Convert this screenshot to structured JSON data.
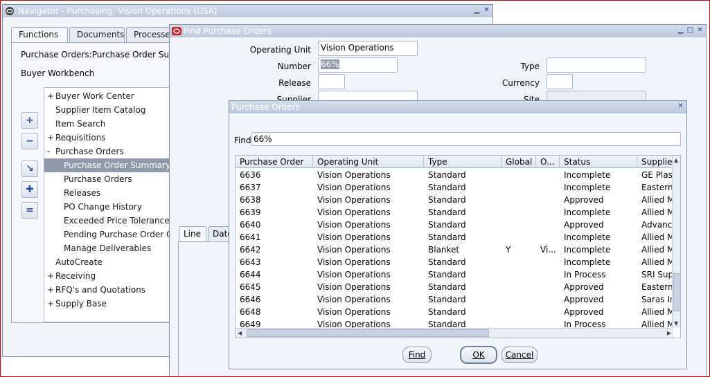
{
  "navigator": {
    "title": "Navigator - Purchasing, Vision Operations (USA)",
    "tabs": [
      "Functions",
      "Documents",
      "Processes"
    ],
    "breadcrumb": "Purchase Orders:Purchase Order Summary",
    "top_item": "Buyer Workbench",
    "tree": [
      {
        "prefix": "+",
        "label": "Buyer Work Center",
        "level": 0,
        "selected": false
      },
      {
        "prefix": "",
        "label": "Supplier Item Catalog",
        "level": 0,
        "selected": false
      },
      {
        "prefix": "",
        "label": "Item Search",
        "level": 0,
        "selected": false
      },
      {
        "prefix": "+",
        "label": "Requisitions",
        "level": 0,
        "selected": false
      },
      {
        "prefix": "-",
        "label": "Purchase Orders",
        "level": 0,
        "selected": false
      },
      {
        "prefix": "",
        "label": "Purchase Order Summary",
        "level": 1,
        "selected": true
      },
      {
        "prefix": "",
        "label": "Purchase Orders",
        "level": 1,
        "selected": false
      },
      {
        "prefix": "",
        "label": "Releases",
        "level": 1,
        "selected": false
      },
      {
        "prefix": "",
        "label": "PO Change History",
        "level": 1,
        "selected": false
      },
      {
        "prefix": "",
        "label": "Exceeded Price Tolerances",
        "level": 1,
        "selected": false
      },
      {
        "prefix": "",
        "label": "Pending Purchase Order Changes",
        "level": 1,
        "selected": false
      },
      {
        "prefix": "",
        "label": "Manage Deliverables",
        "level": 1,
        "selected": false
      },
      {
        "prefix": "",
        "label": "AutoCreate",
        "level": 0,
        "selected": false
      },
      {
        "prefix": "+",
        "label": "Receiving",
        "level": 0,
        "selected": false
      },
      {
        "prefix": "+",
        "label": "RFQ's and Quotations",
        "level": 0,
        "selected": false
      },
      {
        "prefix": "+",
        "label": "Supply Base",
        "level": 0,
        "selected": false
      }
    ]
  },
  "find_window": {
    "title": "Find Purchase Orders",
    "operating_unit_label": "Operating Unit",
    "operating_unit_value": "Vision Operations",
    "number_label": "Number",
    "number_value": "66%",
    "release_label": "Release",
    "supplier_label": "Supplier",
    "type_label": "Type",
    "currency_label": "Currency",
    "site_label": "Site",
    "tabs": [
      "Line",
      "Date"
    ]
  },
  "po_dialog": {
    "title": "Purchase Orders",
    "find_label": "Find",
    "find_value": "66%",
    "columns": [
      "Purchase Order",
      "Operating Unit",
      "Type",
      "Global",
      "O...",
      "Status",
      "Supplier"
    ],
    "rows": [
      [
        "6636",
        "Vision Operations",
        "Standard",
        "",
        "",
        "Incomplete",
        "GE Plas"
      ],
      [
        "6637",
        "Vision Operations",
        "Standard",
        "",
        "",
        "Incomplete",
        "Eastern"
      ],
      [
        "6638",
        "Vision Operations",
        "Standard",
        "",
        "",
        "Approved",
        "Allied M"
      ],
      [
        "6639",
        "Vision Operations",
        "Standard",
        "",
        "",
        "Incomplete",
        "Allied M"
      ],
      [
        "6640",
        "Vision Operations",
        "Standard",
        "",
        "",
        "Approved",
        "Advance"
      ],
      [
        "6641",
        "Vision Operations",
        "Standard",
        "",
        "",
        "Incomplete",
        "Allied M"
      ],
      [
        "6642",
        "Vision Operations",
        "Blanket",
        "Y",
        "Vi...",
        "Incomplete",
        "Allied M"
      ],
      [
        "6643",
        "Vision Operations",
        "Standard",
        "",
        "",
        "Incomplete",
        "Allied M"
      ],
      [
        "6644",
        "Vision Operations",
        "Standard",
        "",
        "",
        "In Process",
        "SRI Sup"
      ],
      [
        "6645",
        "Vision Operations",
        "Standard",
        "",
        "",
        "Approved",
        "Eastern"
      ],
      [
        "6646",
        "Vision Operations",
        "Standard",
        "",
        "",
        "Approved",
        "Saras In"
      ],
      [
        "6648",
        "Vision Operations",
        "Standard",
        "",
        "",
        "Approved",
        "Allied M"
      ],
      [
        "6649",
        "Vision Operations",
        "Standard",
        "",
        "",
        "In Process",
        "Allied M"
      ]
    ],
    "buttons": {
      "find": "Find",
      "ok": "OK",
      "cancel": "Cancel"
    }
  },
  "icons": {
    "oracle": "oracle-icon",
    "minimize": "minimize-icon",
    "restore": "restore-icon",
    "close": "close-icon"
  },
  "colors": {
    "selection": "#8f9aaa",
    "title_bar": "#c9d3e4",
    "window_bg": "#f2f5fa"
  }
}
